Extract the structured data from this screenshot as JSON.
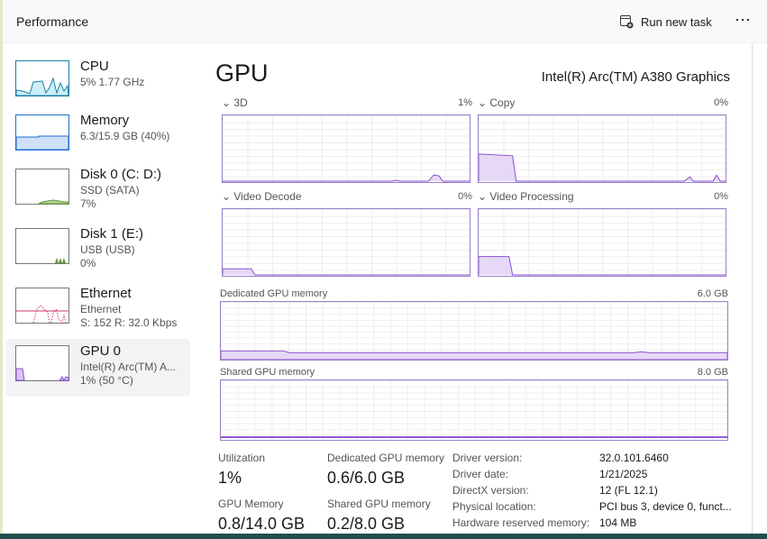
{
  "app": {
    "title": "Performance",
    "run_new_task": "Run new task",
    "more": "⋯"
  },
  "sidebar": {
    "items": [
      {
        "title": "CPU",
        "line1": "5%  1.77 GHz"
      },
      {
        "title": "Memory",
        "line1": "6.3/15.9 GB (40%)"
      },
      {
        "title": "Disk 0 (C: D:)",
        "line1": "SSD (SATA)",
        "line2": "7%"
      },
      {
        "title": "Disk 1 (E:)",
        "line1": "USB (USB)",
        "line2": "0%"
      },
      {
        "title": "Ethernet",
        "line1": "Ethernet",
        "line2": "S: 152  R: 32.0 Kbps"
      },
      {
        "title": "GPU 0",
        "line1": "Intel(R) Arc(TM) A...",
        "line2": "1%  (50 °C)"
      }
    ]
  },
  "main": {
    "heading": "GPU",
    "device": "Intel(R) Arc(TM) A380 Graphics",
    "engines": [
      {
        "label": "3D",
        "value": "1%"
      },
      {
        "label": "Copy",
        "value": "0%"
      },
      {
        "label": "Video Decode",
        "value": "0%"
      },
      {
        "label": "Video Processing",
        "value": "0%"
      }
    ],
    "dedicated": {
      "label": "Dedicated GPU memory",
      "max": "6.0 GB"
    },
    "shared": {
      "label": "Shared GPU memory",
      "max": "8.0 GB"
    },
    "stats": {
      "utilization": {
        "label": "Utilization",
        "value": "1%"
      },
      "dedicated": {
        "label": "Dedicated GPU memory",
        "value": "0.6/6.0 GB"
      },
      "gpu_memory": {
        "label": "GPU Memory",
        "value": "0.8/14.0 GB"
      },
      "shared": {
        "label": "Shared GPU memory",
        "value": "0.2/8.0 GB"
      }
    },
    "props": [
      {
        "k": "Driver version:",
        "v": "32.0.101.6460"
      },
      {
        "k": "Driver date:",
        "v": "1/21/2025"
      },
      {
        "k": "DirectX version:",
        "v": "12 (FL 12.1)"
      },
      {
        "k": "Physical location:",
        "v": "PCI bus 3, device 0, funct..."
      },
      {
        "k": "Hardware reserved memory:",
        "v": "104 MB"
      }
    ]
  },
  "colors": {
    "gpu": "#8a4fd0",
    "gpu_fill": "#e6d8f6",
    "cpu": "#1b7fa8",
    "memory": "#1f6fd0",
    "disk": "#5e9a30",
    "ethernet": "#c8386e"
  }
}
